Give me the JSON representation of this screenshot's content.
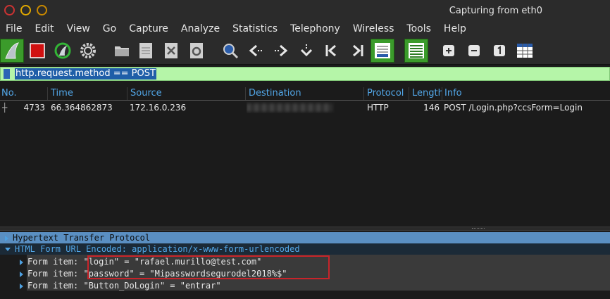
{
  "window": {
    "title": "Capturing from eth0"
  },
  "menu": [
    "File",
    "Edit",
    "View",
    "Go",
    "Capture",
    "Analyze",
    "Statistics",
    "Telephony",
    "Wireless",
    "Tools",
    "Help"
  ],
  "toolbar": {
    "icons": [
      "shark-fin-start-icon",
      "stop-square-icon",
      "restart-capture-icon",
      "capture-options-gear-icon",
      "open-folder-icon",
      "save-file-icon",
      "close-file-icon",
      "reload-file-icon",
      "find-packet-icon",
      "go-back-icon",
      "go-forward-icon",
      "go-to-packet-icon",
      "first-packet-icon",
      "last-packet-icon",
      "auto-scroll-icon",
      "colorize-icon",
      "zoom-in-icon",
      "zoom-out-icon",
      "normal-size-icon",
      "resize-columns-icon"
    ]
  },
  "filter": {
    "value": "http.request.method == POST"
  },
  "packet_list": {
    "columns": [
      "No.",
      "Time",
      "Source",
      "Destination",
      "Protocol",
      "Length",
      "Info"
    ],
    "rows": [
      {
        "no": "4733",
        "time": "66.364862873",
        "source": "172.16.0.236",
        "destination": "",
        "protocol": "HTTP",
        "length": "146",
        "info": "POST /Login.php?ccsForm=Login"
      }
    ]
  },
  "details": {
    "http": "Hypertext Transfer Protocol",
    "form": "HTML Form URL Encoded: application/x-www-form-urlencoded",
    "items": [
      {
        "prefix": "Form item: ",
        "value": "\"login\" = \"rafael.murillo@test.com\""
      },
      {
        "prefix": "Form item: ",
        "value": "\"password\" = \"Mipasswordsegurodel2018%$\""
      },
      {
        "prefix": "Form item: ",
        "value": "\"Button_DoLogin\" = \"entrar\""
      }
    ]
  },
  "colors": {
    "filter_bg": "#b5f5a8",
    "header_text": "#52a7e8",
    "selection": "#5a8fc2",
    "highlight_box": "#c8242a"
  }
}
